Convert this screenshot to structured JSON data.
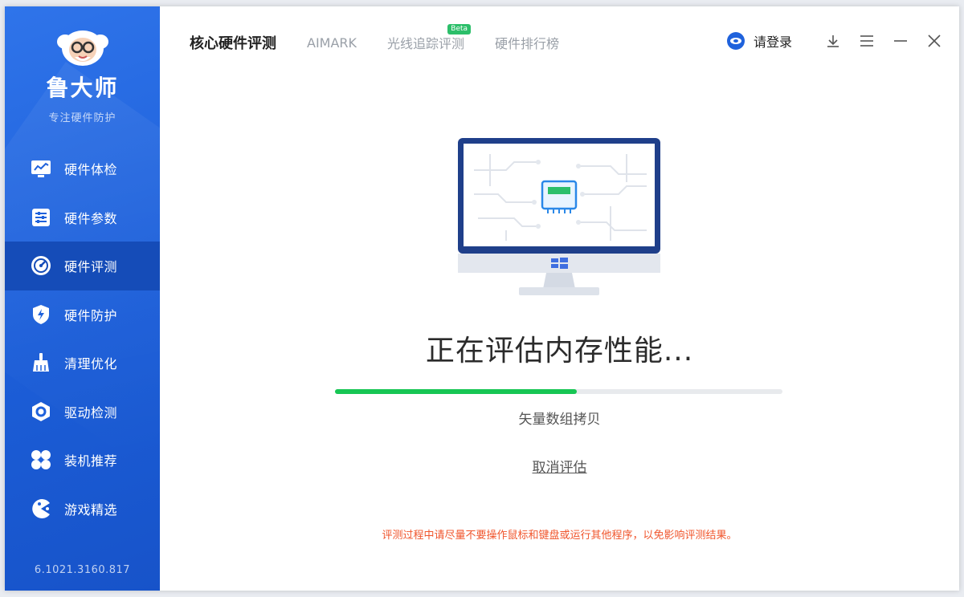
{
  "brand": {
    "name": "鲁大师",
    "slogan": "专注硬件防护",
    "logo_icon": "master-avatar-icon"
  },
  "sidebar": {
    "items": [
      {
        "label": "硬件体检",
        "icon": "chart-monitor-icon",
        "active": false
      },
      {
        "label": "硬件参数",
        "icon": "list-sliders-icon",
        "active": false
      },
      {
        "label": "硬件评测",
        "icon": "gauge-icon",
        "active": true
      },
      {
        "label": "硬件防护",
        "icon": "shield-bolt-icon",
        "active": false
      },
      {
        "label": "清理优化",
        "icon": "broom-icon",
        "active": false
      },
      {
        "label": "驱动检测",
        "icon": "hexagon-gear-icon",
        "active": false
      },
      {
        "label": "装机推荐",
        "icon": "clover-grid-icon",
        "active": false
      },
      {
        "label": "游戏精选",
        "icon": "game-pacman-icon",
        "active": false
      }
    ],
    "version": "6.1021.3160.817"
  },
  "header": {
    "tabs": [
      {
        "label": "核心硬件评测",
        "active": true
      },
      {
        "label": "AIMARK",
        "active": false
      },
      {
        "label": "光线追踪评测",
        "active": false,
        "badge": "Beta"
      },
      {
        "label": "硬件排行榜",
        "active": false
      }
    ],
    "login_label": "请登录",
    "actions": [
      "download-icon",
      "menu-icon",
      "minimize-icon",
      "close-icon"
    ]
  },
  "main": {
    "illustration": "monitor-memory-chip-icon",
    "status_title": "正在评估内存性能...",
    "progress_percent": 54,
    "progress_text": "矢量数组拷贝",
    "cancel_label": "取消评估",
    "warning": "评测过程中请尽量不要操作鼠标和键盘或运行其他程序，以免影响评测结果。"
  },
  "colors": {
    "sidebar": "#1f62dc",
    "sidebar_active": "#154cb8",
    "progress": "#17c654",
    "warning": "#f0552c"
  }
}
